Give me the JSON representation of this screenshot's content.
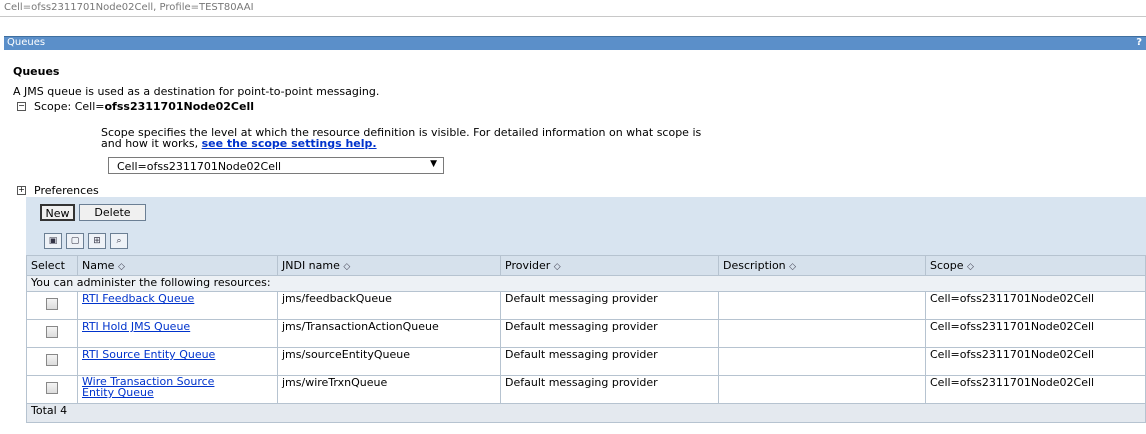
{
  "top": {
    "context": "Cell=ofss2311701Node02Cell, Profile=TEST80AAI"
  },
  "title_bar": {
    "title": "Queues",
    "help": "?"
  },
  "page": {
    "heading": "Queues",
    "description": "A JMS queue is used as a destination for point-to-point messaging.",
    "scope_prefix": "Scope: Cell=",
    "scope_value": "ofss2311701Node02Cell",
    "scope_help_line1": "Scope specifies the level at which the resource definition is visible. For detailed information on what scope is",
    "scope_help_line2": "and how it works, ",
    "scope_help_link": "see the scope settings help.",
    "scope_select": "Cell=ofss2311701Node02Cell",
    "preferences": "Preferences"
  },
  "toolbar": {
    "new_label": "New",
    "delete_label": "Delete"
  },
  "table": {
    "columns": {
      "select": "Select",
      "name": "Name",
      "jndi": "JNDI name",
      "provider": "Provider",
      "description": "Description",
      "scope": "Scope"
    },
    "info": "You can administer the following resources:",
    "rows": [
      {
        "name": "RTI Feedback Queue",
        "jndi": "jms/feedbackQueue",
        "provider": "Default messaging provider",
        "description": "",
        "scope": "Cell=ofss2311701Node02Cell"
      },
      {
        "name": "RTI Hold JMS Queue",
        "jndi": "jms/TransactionActionQueue",
        "provider": "Default messaging provider",
        "description": "",
        "scope": "Cell=ofss2311701Node02Cell"
      },
      {
        "name": "RTI Source Entity Queue",
        "jndi": "jms/sourceEntityQueue",
        "provider": "Default messaging provider",
        "description": "",
        "scope": "Cell=ofss2311701Node02Cell"
      },
      {
        "name_line1": "Wire Transaction Source",
        "name_line2": "Entity Queue",
        "jndi": "jms/wireTrxnQueue",
        "provider": "Default messaging provider",
        "description": "",
        "scope": "Cell=ofss2311701Node02Cell"
      }
    ],
    "total": "Total 4"
  },
  "icons": [
    "select-all-icon",
    "deselect-all-icon",
    "show-filter-icon",
    "clear-filter-icon"
  ]
}
